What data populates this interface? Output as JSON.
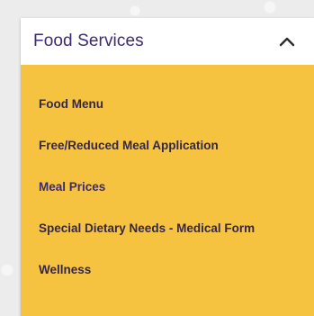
{
  "accordion": {
    "title": "Food Services",
    "toggle_icon": "chevron-up-icon",
    "expanded": true,
    "colors": {
      "header_bg": "#ffffff",
      "title": "#3d2a74",
      "body_bg": "#f5c33f",
      "link": "#33264f",
      "active_link": "#3d2a74"
    },
    "items": [
      {
        "label": "Food Menu"
      },
      {
        "label": "Free/Reduced Meal Application"
      },
      {
        "label": "Meal Prices"
      },
      {
        "label": "Special Dietary Needs - Medical Form"
      },
      {
        "label": "Wellness"
      }
    ]
  }
}
